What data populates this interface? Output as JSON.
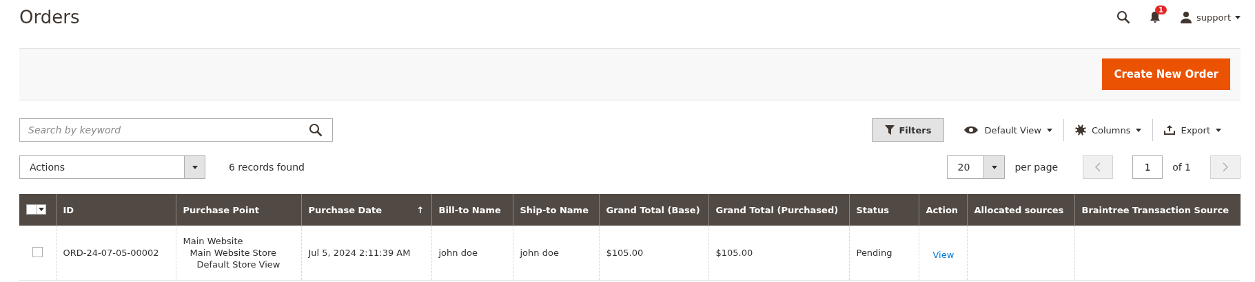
{
  "header": {
    "title": "Orders",
    "notifications": "1",
    "user": "support"
  },
  "action_bar": {
    "primary_button": "Create New Order"
  },
  "toolbar": {
    "search": {
      "placeholder": "Search by keyword"
    },
    "filters": "Filters",
    "view": "Default View",
    "columns": "Columns",
    "export": "Export",
    "actions": "Actions",
    "records": "6 records found",
    "per_page_value": "20",
    "per_page_label": "per page",
    "page": "1",
    "page_total": "of 1"
  },
  "table": {
    "mass_select": {
      "checked": false
    },
    "columns": [
      {
        "label": "ID"
      },
      {
        "label": "Purchase Point"
      },
      {
        "label": "Purchase Date",
        "sort_mark": "↑"
      },
      {
        "label": "Bill-to Name"
      },
      {
        "label": "Ship-to Name"
      },
      {
        "label": "Grand Total (Base)"
      },
      {
        "label": "Grand Total (Purchased)"
      },
      {
        "label": "Status"
      },
      {
        "label": "Action"
      },
      {
        "label": "Allocated sources"
      },
      {
        "label": "Braintree Transaction Source"
      }
    ],
    "rows": [
      {
        "checked": false,
        "id": "ORD-24-07-05-00002",
        "purchase_point": [
          "Main Website",
          "Main Website Store",
          "Default Store View"
        ],
        "purchase_date": "Jul 5, 2024 2:11:39 AM",
        "bill_to": "john doe",
        "ship_to": "john doe",
        "grand_total_base": "$105.00",
        "grand_total_purchased": "$105.00",
        "status": "Pending",
        "action": "View"
      }
    ]
  }
}
